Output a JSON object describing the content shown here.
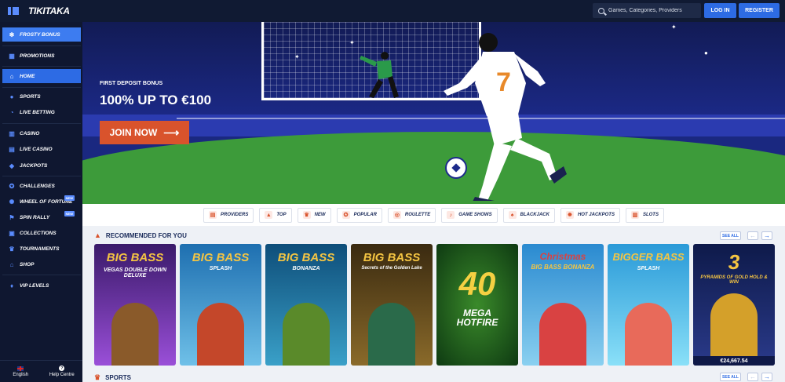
{
  "header": {
    "logo": "TIKITAKA",
    "search_placeholder": "Games, Categories, Providers",
    "login_label": "LOG IN",
    "register_label": "REGISTER"
  },
  "sidebar": {
    "items": [
      {
        "label": "FROSTY BONUS",
        "icon": "snowflake-icon"
      },
      {
        "label": "PROMOTIONS",
        "icon": "gift-icon"
      },
      {
        "label": "HOME",
        "icon": "home-icon"
      },
      {
        "label": "SPORTS",
        "icon": "ball-icon"
      },
      {
        "label": "LIVE BETTING",
        "icon": "live-icon"
      },
      {
        "label": "CASINO",
        "icon": "cards-icon"
      },
      {
        "label": "LIVE CASINO",
        "icon": "dealer-icon"
      },
      {
        "label": "JACKPOTS",
        "icon": "jackpot-icon"
      },
      {
        "label": "CHALLENGES",
        "icon": "challenge-icon"
      },
      {
        "label": "WHEEL OF FORTUNE",
        "icon": "wheel-icon",
        "badge": "NEW"
      },
      {
        "label": "SPIN RALLY",
        "icon": "rally-icon",
        "badge": "NEW"
      },
      {
        "label": "COLLECTIONS",
        "icon": "collection-icon"
      },
      {
        "label": "TOURNAMENTS",
        "icon": "trophy-icon"
      },
      {
        "label": "SHOP",
        "icon": "shop-icon"
      },
      {
        "label": "VIP LEVELS",
        "icon": "vip-icon"
      }
    ],
    "footer": {
      "language": "English",
      "help": "Help Centre"
    }
  },
  "hero": {
    "subtitle": "FIRST DEPOSIT BONUS",
    "title": "100% UP TO €100",
    "cta": "JOIN NOW",
    "player_number": "7"
  },
  "categories": [
    {
      "label": "PROVIDERS",
      "icon": "providers-icon"
    },
    {
      "label": "TOP",
      "icon": "top-icon"
    },
    {
      "label": "NEW",
      "icon": "new-icon"
    },
    {
      "label": "POPULAR",
      "icon": "popular-icon"
    },
    {
      "label": "ROULETTE",
      "icon": "roulette-icon"
    },
    {
      "label": "GAME SHOWS",
      "icon": "mic-icon"
    },
    {
      "label": "BLACKJACK",
      "icon": "blackjack-icon"
    },
    {
      "label": "HOT JACKPOTS",
      "icon": "hot-jackpot-icon"
    },
    {
      "label": "SLOTS",
      "icon": "slots-icon"
    }
  ],
  "recommended": {
    "title": "RECOMMENDED FOR YOU",
    "see_all": "SEE ALL",
    "games": [
      {
        "title": "BIG BASS",
        "subtitle": "VEGAS DOUBLE DOWN DELUXE",
        "bg": "#7a3fb5",
        "accent": "#f5c542"
      },
      {
        "title": "BIG BASS",
        "subtitle": "SPLASH",
        "bg": "#4fa3d8",
        "accent": "#f5c542"
      },
      {
        "title": "BIG BASS",
        "subtitle": "BONANZA",
        "bg": "#2a8bb8",
        "accent": "#f5c542"
      },
      {
        "title": "BIG BASS",
        "subtitle": "Secrets of the Golden Lake",
        "bg": "#6a5a2a",
        "accent": "#f5c542"
      },
      {
        "title": "40",
        "subtitle": "MEGA HOTFIRE",
        "bg": "#2a6a2a",
        "accent": "#f5d042"
      },
      {
        "title": "Christmas",
        "subtitle": "BIG BASS BONANZA",
        "bg": "#5ab0e0",
        "accent": "#d94242"
      },
      {
        "title": "BIGGER BASS",
        "subtitle": "SPLASH",
        "bg": "#5fc0e8",
        "accent": "#f5c542"
      },
      {
        "title": "3",
        "subtitle": "PYRAMIDS OF GOLD HOLD & WIN",
        "bg": "#1a2a6a",
        "accent": "#f5c542",
        "jackpot": "€24,667.54"
      }
    ]
  },
  "sports": {
    "title": "SPORTS",
    "see_all": "SEE ALL"
  }
}
